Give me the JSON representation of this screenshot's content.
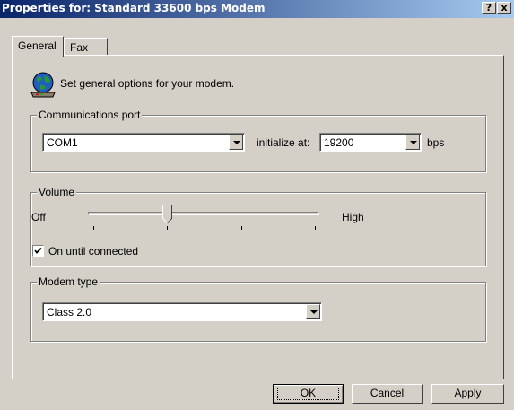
{
  "window": {
    "title": "Properties for: Standard 33600 bps Modem",
    "help_glyph": "?",
    "close_glyph": "x"
  },
  "tabs": [
    {
      "label": "General",
      "selected": true
    },
    {
      "label": "Fax",
      "selected": false
    }
  ],
  "general": {
    "icon": "modem-globe-icon",
    "intro_text": "Set general options for your modem.",
    "communications_port": {
      "legend": "Communications port",
      "port_value": "COM1",
      "initialize_label": "initialize at:",
      "speed_value": "19200",
      "units_label": "bps"
    },
    "volume": {
      "legend": "Volume",
      "low_label": "Off",
      "high_label": "High",
      "level": 0.33,
      "ticks": 4,
      "checkbox_label": "On until connected",
      "checkbox_checked": true
    },
    "modem_type": {
      "legend": "Modem type",
      "value": "Class 2.0"
    }
  },
  "buttons": {
    "ok": "OK",
    "cancel": "Cancel",
    "apply": "Apply"
  },
  "colors": {
    "face": "#d4d0c8",
    "title_start": "#0a246a",
    "title_end": "#a6caf0"
  }
}
